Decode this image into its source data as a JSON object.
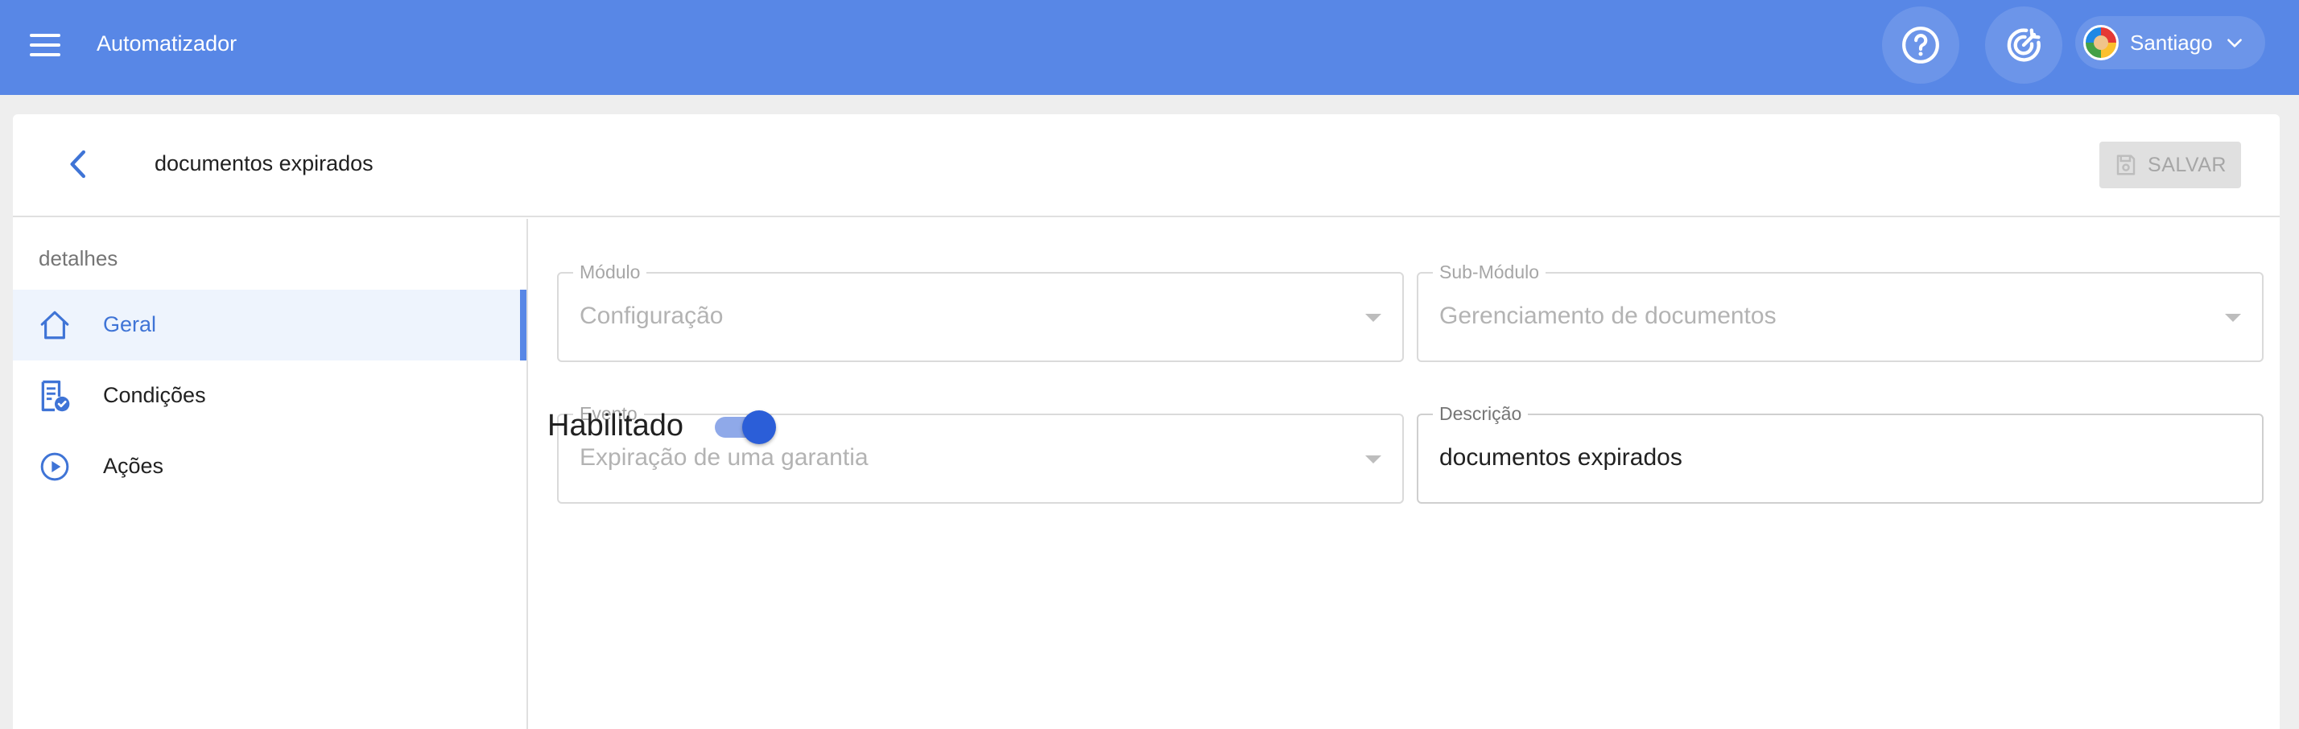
{
  "topbar": {
    "app_title": "Automatizador",
    "user_name": "Santiago",
    "icons": [
      "menu-icon",
      "help-icon",
      "target-icon",
      "chevron-down-icon"
    ],
    "color": "#5887e6"
  },
  "header": {
    "title": "documentos expirados",
    "save_label": "SALVAR"
  },
  "sidebar": {
    "heading": "detalhes",
    "items": [
      {
        "label": "Geral",
        "icon": "home-icon",
        "active": true
      },
      {
        "label": "Condições",
        "icon": "conditions-icon",
        "active": false
      },
      {
        "label": "Ações",
        "icon": "play-circle-icon",
        "active": false
      }
    ]
  },
  "form": {
    "modulo": {
      "label": "Módulo",
      "value": "Configuração"
    },
    "submodulo": {
      "label": "Sub-Módulo",
      "value": "Gerenciamento de documentos"
    },
    "evento": {
      "label": "Evento",
      "value": "Expiração de uma garantia"
    },
    "descricao": {
      "label": "Descrição",
      "value": "documentos expirados"
    },
    "habilitado": {
      "label": "Habilitado",
      "enabled": true
    }
  }
}
